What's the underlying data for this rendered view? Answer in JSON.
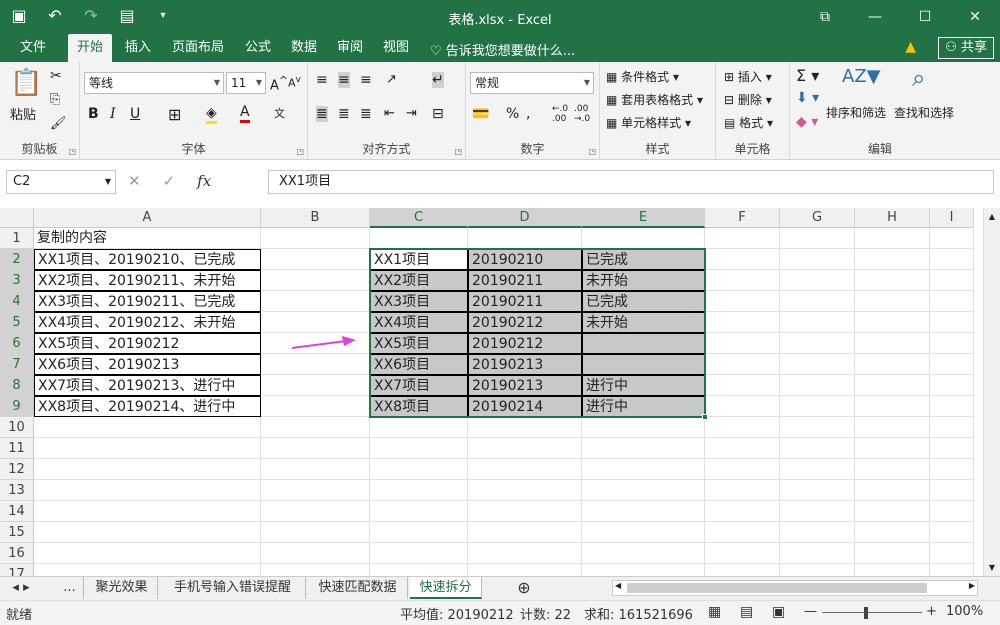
{
  "window": {
    "title": "表格.xlsx - Excel"
  },
  "tabs": [
    "文件",
    "开始",
    "插入",
    "页面布局",
    "公式",
    "数据",
    "审阅",
    "视图"
  ],
  "tell_me": "告诉我您想要做什么...",
  "share": "共享",
  "ribbon": {
    "clipboard": {
      "label": "剪贴板",
      "paste": "粘贴"
    },
    "font": {
      "label": "字体",
      "name": "等线",
      "size": "11"
    },
    "alignment": {
      "label": "对齐方式"
    },
    "number": {
      "label": "数字",
      "format": "常规"
    },
    "styles": {
      "label": "样式",
      "cond": "条件格式",
      "table": "套用表格格式",
      "cell": "单元格样式"
    },
    "cells": {
      "label": "单元格",
      "insert": "插入",
      "delete": "删除",
      "format": "格式"
    },
    "editing": {
      "label": "编辑",
      "sort": "排序和筛选",
      "find": "查找和选择"
    }
  },
  "formula_bar": {
    "name_box": "C2",
    "content": "XX1项目"
  },
  "columns": [
    "A",
    "B",
    "C",
    "D",
    "E",
    "F",
    "G",
    "H",
    "I"
  ],
  "rows": [
    "1",
    "2",
    "3",
    "4",
    "5",
    "6",
    "7",
    "8",
    "9",
    "10",
    "11",
    "12",
    "13",
    "14",
    "15",
    "16",
    "17"
  ],
  "colA": [
    "复制的内容",
    "XX1项目、20190210、已完成",
    "XX2项目、20190211、未开始",
    "XX3项目、20190211、已完成",
    "XX4项目、20190212、未开始",
    "XX5项目、20190212",
    "XX6项目、20190213",
    "XX7项目、20190213、进行中",
    "XX8项目、20190214、进行中"
  ],
  "colC": [
    "XX1项目",
    "XX2项目",
    "XX3项目",
    "XX4项目",
    "XX5项目",
    "XX6项目",
    "XX7项目",
    "XX8项目"
  ],
  "colD": [
    "20190210",
    "20190211",
    "20190211",
    "20190212",
    "20190212",
    "20190213",
    "20190213",
    "20190214"
  ],
  "colE": [
    "已完成",
    "未开始",
    "已完成",
    "未开始",
    "",
    "",
    "进行中",
    "进行中"
  ],
  "sheets": [
    "聚光效果",
    "手机号输入错误提醒",
    "快速匹配数据",
    "快速拆分"
  ],
  "sheet_more": "...",
  "status": {
    "ready": "就绪",
    "average": "平均值: 20190212",
    "count": "计数: 22",
    "sum": "求和: 161521696",
    "zoom": "100%"
  },
  "colors": {
    "accent": "#217346",
    "arrow": "#e040e0"
  }
}
